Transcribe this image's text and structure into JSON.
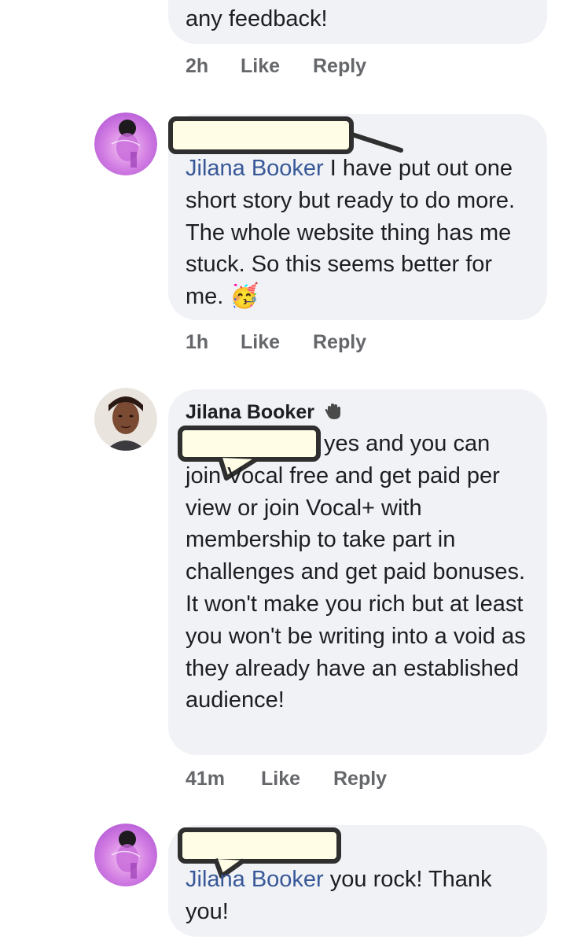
{
  "comments": [
    {
      "text": "any feedback!",
      "time": "2h",
      "like_label": "Like",
      "reply_label": "Reply"
    },
    {
      "mention": "Jilana Booker",
      "text": " I have put out one short story but ready to do more.  The whole website thing has me stuck.  So this seems better for me.",
      "emoji": "🥳",
      "time": "1h",
      "like_label": "Like",
      "reply_label": "Reply"
    },
    {
      "author": "Jilana Booker",
      "author_icon": "waving-hand-icon",
      "text_line1": "yes and you can",
      "text_rest": "join Vocal free and get paid per view or join Vocal+ with membership to take part in challenges and get paid bonuses. It won't make you rich but at least you won't be writing into a void as they already have an established audience!",
      "time": "41m",
      "like_label": "Like",
      "reply_label": "Reply"
    },
    {
      "mention": "Jilana Booker",
      "text": " you rock!  Thank you!"
    }
  ],
  "colors": {
    "bubble": "#f0f2f5",
    "mention": "#385898",
    "meta": "#65676b",
    "redaction_fill": "#fffde5",
    "redaction_border": "#2f2f2f"
  }
}
